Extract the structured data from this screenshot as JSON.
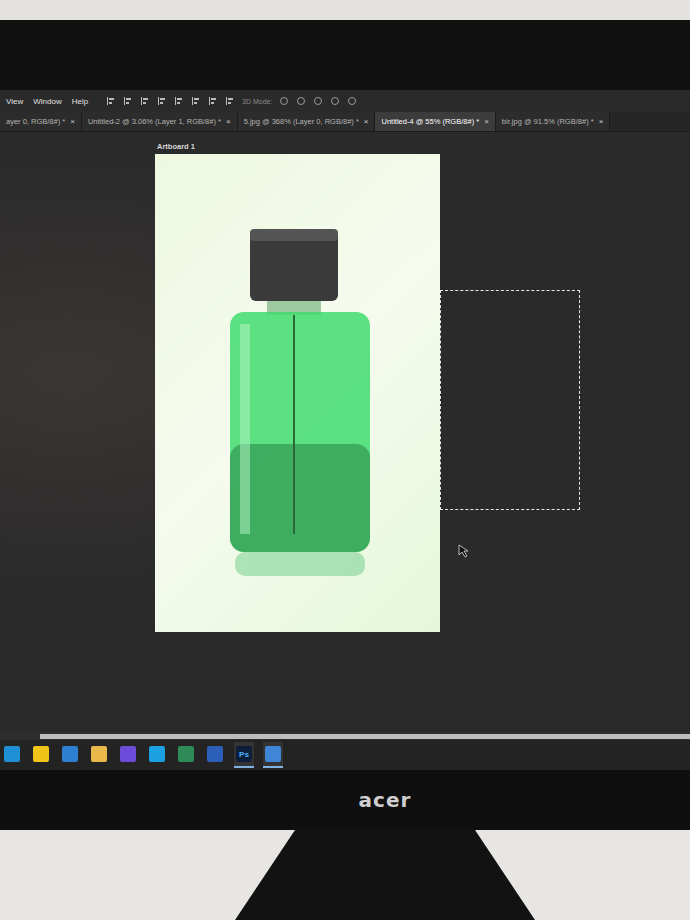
{
  "menu": [
    {
      "label": "View"
    },
    {
      "label": "Window"
    },
    {
      "label": "Help"
    }
  ],
  "options_bar": {
    "mode_label": "3D Mode:"
  },
  "tabs": [
    {
      "label": "ayer 0, RGB/8#) *",
      "close": "×",
      "selected": false
    },
    {
      "label": "Untitled-2 @ 3.06% (Layer 1, RGB/8#) *",
      "close": "×",
      "selected": false
    },
    {
      "label": "5.jpg @ 368% (Layer 0, RGB/8#) *",
      "close": "×",
      "selected": false
    },
    {
      "label": "Untitled-4 @ 55% (RGB/8#) *",
      "close": "×",
      "selected": true
    },
    {
      "label": "bir.jpg @ 91.5% (RGB/8#) *",
      "close": "×",
      "selected": false
    }
  ],
  "artboard": {
    "label": "Artboard 1"
  },
  "taskbar": {
    "apps": [
      {
        "kind": "edge",
        "active": false
      },
      {
        "kind": "store",
        "active": false
      },
      {
        "kind": "mail",
        "active": false
      },
      {
        "kind": "folder",
        "active": false
      },
      {
        "kind": "game",
        "active": false
      },
      {
        "kind": "skype",
        "active": false
      },
      {
        "kind": "excel",
        "active": false
      },
      {
        "kind": "word",
        "active": false
      },
      {
        "kind": "photoshop",
        "label": "Ps",
        "active": true
      },
      {
        "kind": "photos",
        "active": true
      }
    ]
  },
  "monitor": {
    "brand": "acer"
  }
}
